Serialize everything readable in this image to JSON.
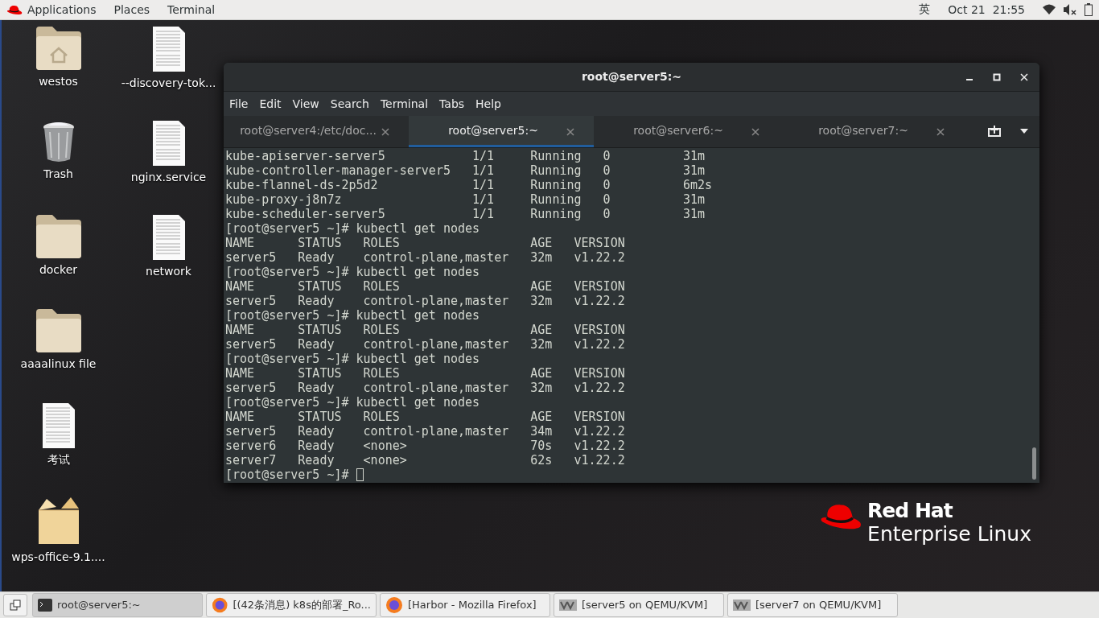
{
  "top_bar": {
    "menus": [
      "Applications",
      "Places",
      "Terminal"
    ],
    "input_method": "英",
    "clock": "Oct 21  21:55"
  },
  "desktop": {
    "columns": [
      [
        {
          "label": "westos",
          "kind": "home-folder"
        },
        {
          "label": "Trash",
          "kind": "trash"
        },
        {
          "label": "docker",
          "kind": "folder"
        },
        {
          "label": "aaaalinux file",
          "kind": "folder"
        },
        {
          "label": "考试",
          "kind": "document"
        },
        {
          "label": "wps-office-9.1....",
          "kind": "package"
        }
      ],
      [
        {
          "label": "--discovery-tok...",
          "kind": "document"
        },
        {
          "label": "nginx.service",
          "kind": "document"
        },
        {
          "label": "network",
          "kind": "document"
        }
      ]
    ]
  },
  "window": {
    "title": "root@server5:~",
    "menu": [
      "File",
      "Edit",
      "View",
      "Search",
      "Terminal",
      "Tabs",
      "Help"
    ],
    "tabs": [
      {
        "label": "root@server4:/etc/doc...",
        "selected": false
      },
      {
        "label": "root@server5:~",
        "selected": true
      },
      {
        "label": "root@server6:~",
        "selected": false
      },
      {
        "label": "root@server7:~",
        "selected": false
      }
    ],
    "lines": [
      "kube-apiserver-server5            1/1     Running   0          31m",
      "kube-controller-manager-server5   1/1     Running   0          31m",
      "kube-flannel-ds-2p5d2             1/1     Running   0          6m2s",
      "kube-proxy-j8n7z                  1/1     Running   0          31m",
      "kube-scheduler-server5            1/1     Running   0          31m",
      "[root@server5 ~]# kubectl get nodes",
      "NAME      STATUS   ROLES                  AGE   VERSION",
      "server5   Ready    control-plane,master   32m   v1.22.2",
      "[root@server5 ~]# kubectl get nodes",
      "NAME      STATUS   ROLES                  AGE   VERSION",
      "server5   Ready    control-plane,master   32m   v1.22.2",
      "[root@server5 ~]# kubectl get nodes",
      "NAME      STATUS   ROLES                  AGE   VERSION",
      "server5   Ready    control-plane,master   32m   v1.22.2",
      "[root@server5 ~]# kubectl get nodes",
      "NAME      STATUS   ROLES                  AGE   VERSION",
      "server5   Ready    control-plane,master   32m   v1.22.2",
      "[root@server5 ~]# kubectl get nodes",
      "NAME      STATUS   ROLES                  AGE   VERSION",
      "server5   Ready    control-plane,master   34m   v1.22.2",
      "server6   Ready    <none>                 70s   v1.22.2",
      "server7   Ready    <none>                 62s   v1.22.2"
    ],
    "prompt": "[root@server5 ~]#"
  },
  "logo": {
    "line_1": "Red Hat",
    "line_2": "Enterprise Linux"
  },
  "taskbar": [
    {
      "label": "root@server5:~",
      "kind": "terminal",
      "selected": true
    },
    {
      "label": "[(42条消息) k8s的部署_Ro...",
      "kind": "browser",
      "selected": false
    },
    {
      "label": "[Harbor - Mozilla Firefox]",
      "kind": "browser",
      "selected": false
    },
    {
      "label": "[server5 on QEMU/KVM]",
      "kind": "vm",
      "selected": false
    },
    {
      "label": "[server7 on QEMU/KVM]",
      "kind": "vm",
      "selected": false
    }
  ]
}
